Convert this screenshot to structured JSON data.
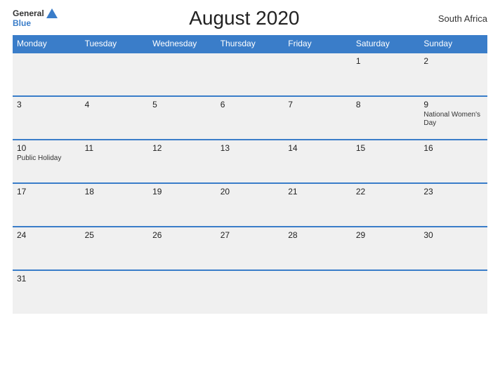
{
  "logo": {
    "general": "General",
    "blue": "Blue"
  },
  "header": {
    "title": "August 2020",
    "country": "South Africa"
  },
  "days": [
    "Monday",
    "Tuesday",
    "Wednesday",
    "Thursday",
    "Friday",
    "Saturday",
    "Sunday"
  ],
  "weeks": {
    "0": [
      "",
      "",
      "",
      "",
      "",
      "1",
      "2"
    ],
    "1": [
      "3",
      "4",
      "5",
      "6",
      "7",
      "8",
      "9"
    ],
    "2": [
      "10",
      "11",
      "12",
      "13",
      "14",
      "15",
      "16"
    ],
    "3": [
      "17",
      "18",
      "19",
      "20",
      "21",
      "22",
      "23"
    ],
    "4": [
      "24",
      "25",
      "26",
      "27",
      "28",
      "29",
      "30"
    ],
    "5": [
      "31",
      "",
      "",
      "",
      "",
      "",
      ""
    ]
  },
  "holidays": {
    "9": "National Women's Day",
    "10": "Public Holiday"
  }
}
